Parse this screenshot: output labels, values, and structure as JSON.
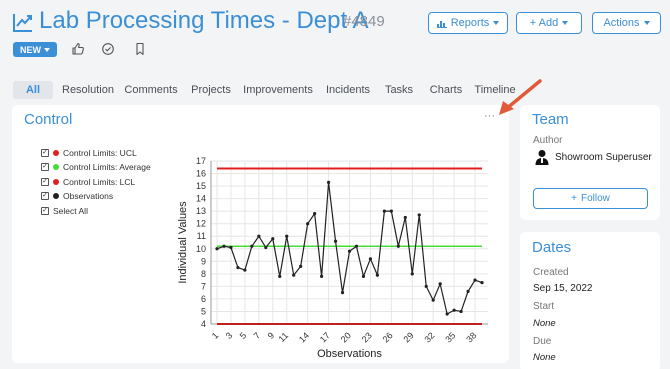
{
  "header": {
    "title": "Lab Processing Times - Dept A",
    "id": "#4849",
    "buttons": {
      "reports": "Reports",
      "add": "+ Add",
      "actions": "Actions"
    }
  },
  "status": {
    "label": "NEW"
  },
  "tabs": [
    "All",
    "Resolution",
    "Comments",
    "Projects",
    "Improvements",
    "Incidents",
    "Tasks",
    "Charts",
    "Timeline"
  ],
  "control": {
    "title": "Control",
    "menu": "···",
    "legend": [
      {
        "label": "Control Limits: UCL",
        "color": "#e02020"
      },
      {
        "label": "Control Limits: Average",
        "color": "#44dd33"
      },
      {
        "label": "Control Limits: LCL",
        "color": "#e02020"
      },
      {
        "label": "Observations",
        "color": "#222222"
      }
    ],
    "select_all": "Select All"
  },
  "team": {
    "title": "Team",
    "author_label": "Author",
    "author_name": "Showroom Superuser",
    "follow": "Follow"
  },
  "dates": {
    "title": "Dates",
    "created_label": "Created",
    "created_value": "Sep 15, 2022",
    "start_label": "Start",
    "start_value": "None",
    "due_label": "Due",
    "due_value": "None"
  },
  "chart_data": {
    "type": "line",
    "xlabel": "Observations",
    "ylabel": "Individual Values",
    "ylim": [
      4,
      17
    ],
    "xlim": [
      1,
      38
    ],
    "yticks": [
      4,
      5,
      6,
      7,
      8,
      9,
      10,
      11,
      12,
      13,
      14,
      15,
      16,
      17
    ],
    "xticks": [
      1,
      3,
      5,
      7,
      9,
      11,
      14,
      17,
      20,
      23,
      26,
      29,
      32,
      35,
      38
    ],
    "grid": true,
    "ucl": 16.4,
    "average": 10.2,
    "lcl": 4.0,
    "series": [
      {
        "name": "Observations",
        "x": [
          1,
          2,
          3,
          4,
          5,
          6,
          7,
          8,
          9,
          10,
          11,
          12,
          13,
          14,
          15,
          16,
          17,
          18,
          19,
          20,
          21,
          22,
          23,
          24,
          25,
          26,
          27,
          28,
          29,
          30,
          31,
          32,
          33,
          34,
          35,
          36,
          37,
          38,
          39
        ],
        "values": [
          10.0,
          10.2,
          10.1,
          8.5,
          8.3,
          10.2,
          11.0,
          10.1,
          10.8,
          7.8,
          11.0,
          7.9,
          8.6,
          12.0,
          12.8,
          7.8,
          15.3,
          10.6,
          6.5,
          9.8,
          10.2,
          7.8,
          9.2,
          7.9,
          13.0,
          13.0,
          10.2,
          12.5,
          8.0,
          12.7,
          7.0,
          5.9,
          7.2,
          4.8,
          5.1,
          5.0,
          6.6,
          7.5,
          7.3
        ]
      }
    ]
  }
}
